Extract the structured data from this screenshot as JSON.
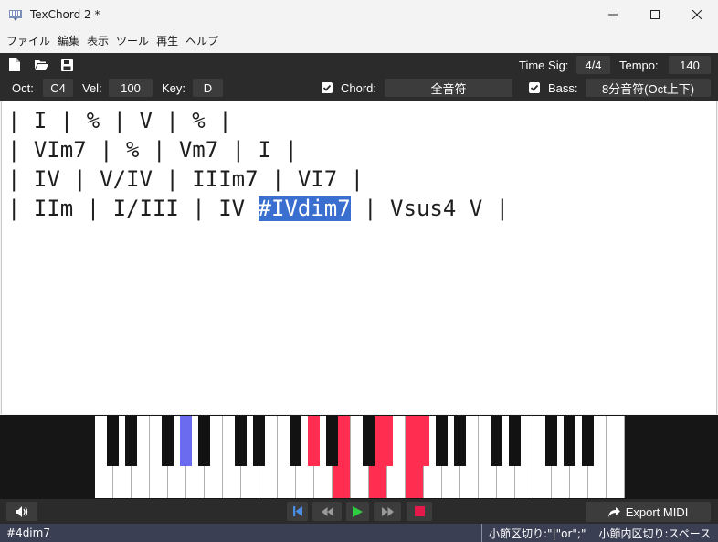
{
  "window": {
    "title": "TexChord 2 *",
    "minimize": "—",
    "maximize": "☐",
    "close": "✕"
  },
  "menu": [
    "ファイル",
    "編集",
    "表示",
    "ツール",
    "再生",
    "ヘルプ"
  ],
  "toolbar": {
    "icons": [
      "new-file-icon",
      "open-folder-icon",
      "save-icon"
    ],
    "time_sig_label": "Time Sig:",
    "time_sig_value": "4/4",
    "tempo_label": "Tempo:",
    "tempo_value": "140",
    "oct_label": "Oct:",
    "oct_value": "C4",
    "vel_label": "Vel:",
    "vel_value": "100",
    "key_label": "Key:",
    "key_value": "D",
    "chord_label": "Chord:",
    "chord_checked": true,
    "chord_value": "全音符",
    "bass_label": "Bass:",
    "bass_checked": true,
    "bass_value": "8分音符(Oct上下)"
  },
  "editor": {
    "lines": [
      "| I | % | V | % |",
      "| VIm7 | % | Vm7 | I |",
      "| IV | V/IV | IIIm7 | VI7 |"
    ],
    "line4_before": "| IIm | I/III | IV ",
    "line4_selected": "#IVdim7",
    "line4_after": " | Vsus4 V |"
  },
  "piano": {
    "white_keys": 29,
    "highlight_red": "#ff2d4f",
    "highlight_blue": "#6b6bf0",
    "pressed_white": [
      13,
      15,
      17
    ],
    "pressed_black": [
      {
        "after_white": 11,
        "color": "red"
      },
      {
        "after_white": 15,
        "color": "red"
      },
      {
        "after_white": 17,
        "color": "red"
      },
      {
        "after_white": 4,
        "color": "blue"
      }
    ]
  },
  "transport": {
    "volume_icon": "speaker-icon",
    "buttons": [
      "skip-to-start-icon",
      "rewind-icon",
      "play-icon",
      "fast-forward-icon",
      "stop-icon"
    ],
    "export_label": "Export MIDI"
  },
  "status": {
    "left": "#4dim7",
    "bar_sep_hint": "小節区切り:\"|\"or\";\"",
    "beat_sep_hint": "小節内区切り:スペース"
  }
}
